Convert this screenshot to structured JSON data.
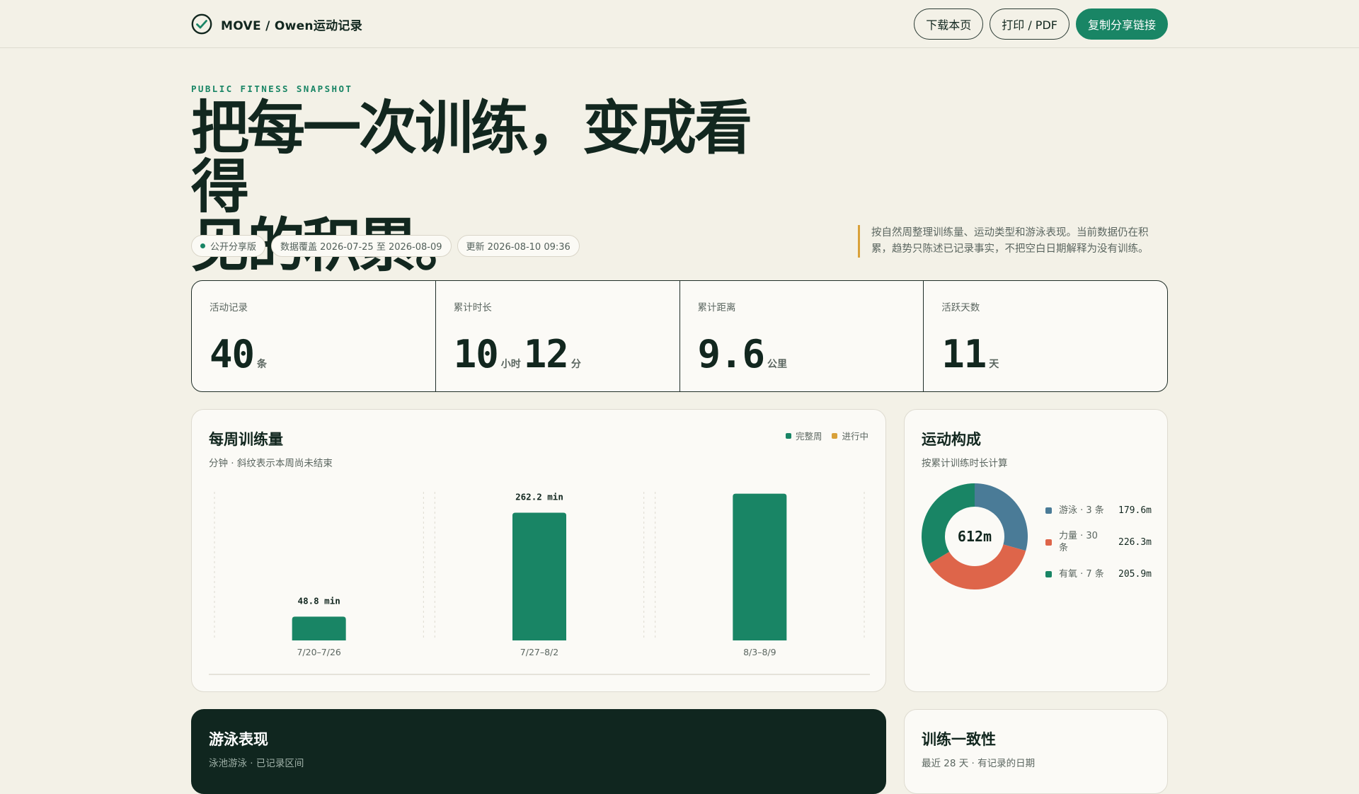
{
  "header": {
    "brand": "MOVE / Owen运动记录",
    "buttons": {
      "download": "下载本页",
      "print": "打印 / PDF",
      "share": "复制分享链接"
    }
  },
  "hero": {
    "eyebrow": "PUBLIC FITNESS SNAPSHOT",
    "title_line1": "把每一次训练，变成看得",
    "title_line2": "见的积累。",
    "chips": {
      "public": "公开分享版",
      "coverage": "数据覆盖 2026-07-25 至 2026-08-09",
      "updated": "更新 2026-08-10 09:36"
    },
    "note": "按自然周整理训练量、运动类型和游泳表现。当前数据仍在积累，趋势只陈述已记录事实，不把空白日期解释为没有训练。"
  },
  "stats": {
    "records": {
      "label": "活动记录",
      "value": "40",
      "unit": "条"
    },
    "duration": {
      "label": "累计时长",
      "hours": "10",
      "hours_unit": "小时",
      "minutes": "12",
      "minutes_unit": "分"
    },
    "distance": {
      "label": "累计距离",
      "value": "9.6",
      "unit": "公里"
    },
    "active_days": {
      "label": "活跃天数",
      "value": "11",
      "unit": "天"
    }
  },
  "weekly": {
    "title": "每周训练量",
    "subtitle": "分钟 · 斜纹表示本周尚未结束",
    "legend": {
      "complete": "完整周",
      "in_progress": "进行中"
    },
    "colors": {
      "complete": "#198565",
      "in_progress": "#d9a13a"
    }
  },
  "chart_data": {
    "type": "bar",
    "categories": [
      "7/20–7/26",
      "7/27–8/2",
      "8/3–8/9"
    ],
    "values": [
      48.8,
      262.2,
      301.1
    ],
    "data_labels": [
      "48.8 min",
      "262.2 min",
      ""
    ],
    "ylim": [
      0,
      305
    ],
    "grid": true
  },
  "mix": {
    "title": "运动构成",
    "subtitle": "按累计训练时长计算",
    "center_label": "612m",
    "items": [
      {
        "name": "游泳 · 3 条",
        "value_label": "179.6m",
        "minutes": 179.6,
        "color": "#4a7b97"
      },
      {
        "name": "力量 · 30 条",
        "value_label": "226.3m",
        "minutes": 226.3,
        "color": "#de654a"
      },
      {
        "name": "有氧 · 7 条",
        "value_label": "205.9m",
        "minutes": 205.9,
        "color": "#198565"
      }
    ]
  },
  "swim": {
    "title": "游泳表现",
    "subtitle": "泳池游泳 · 已记录区间"
  },
  "consistency": {
    "title": "训练一致性",
    "subtitle": "最近 28 天 · 有记录的日期"
  }
}
